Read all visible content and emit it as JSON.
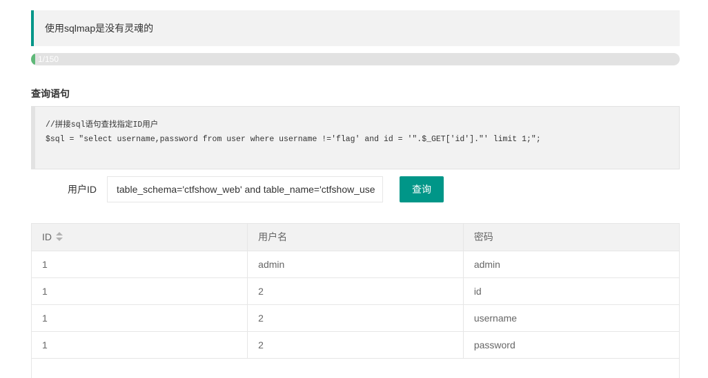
{
  "notice": {
    "text": "使用sqlmap是没有灵魂的"
  },
  "progress": {
    "label": "1/150",
    "value": 1,
    "max": 150
  },
  "query_section": {
    "title": "查询语句",
    "code_lines": [
      "//拼接sql语句查找指定ID用户",
      "$sql = \"select username,password from user where username !='flag' and id = '\".$_GET['id'].\"' limit 1;\";"
    ]
  },
  "form": {
    "label": "用户ID",
    "input_value": "table_schema='ctfshow_web' and table_name='ctfshow_user'",
    "submit_label": "查询"
  },
  "table": {
    "columns": [
      "ID",
      "用户名",
      "密码"
    ],
    "rows": [
      [
        "1",
        "admin",
        "admin"
      ],
      [
        "1",
        "2",
        "id"
      ],
      [
        "1",
        "2",
        "username"
      ],
      [
        "1",
        "2",
        "password"
      ]
    ]
  },
  "colors": {
    "accent": "#009688",
    "progress": "#5fb878"
  }
}
